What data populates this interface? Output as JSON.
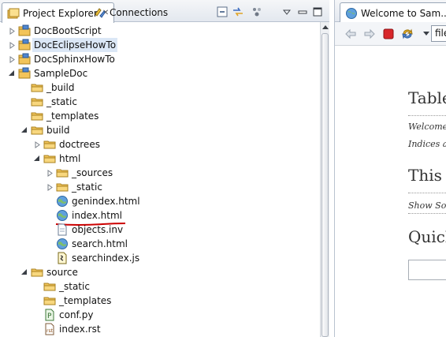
{
  "left_tabs": [
    {
      "label": "Project Explorer",
      "icon": "project-explorer-icon",
      "active": true
    },
    {
      "label": "Connections",
      "icon": "connections-icon",
      "active": false
    }
  ],
  "left_toolbar": [
    "collapse-all-icon",
    "link-with-editor-icon",
    "filter-icon",
    "view-menu-icon",
    "minimize-icon",
    "maximize-icon"
  ],
  "tree": [
    {
      "label": "DocBootScript",
      "icon": "project-icon",
      "expanded": false
    },
    {
      "label": "DocEclipseHowTo",
      "icon": "project-icon",
      "expanded": false,
      "highlighted": true
    },
    {
      "label": "DocSphinxHowTo",
      "icon": "project-icon",
      "expanded": false
    },
    {
      "label": "SampleDoc",
      "icon": "project-icon",
      "expanded": true
    },
    {
      "label": "_build",
      "icon": "folder-icon"
    },
    {
      "label": "_static",
      "icon": "folder-icon"
    },
    {
      "label": "_templates",
      "icon": "folder-icon"
    },
    {
      "label": "build",
      "icon": "folder-icon",
      "expanded": true
    },
    {
      "label": "doctrees",
      "icon": "folder-icon",
      "expanded": false
    },
    {
      "label": "html",
      "icon": "folder-icon",
      "expanded": true
    },
    {
      "label": "_sources",
      "icon": "folder-icon",
      "expanded": false
    },
    {
      "label": "_static",
      "icon": "folder-icon",
      "expanded": false
    },
    {
      "label": "genindex.html",
      "icon": "globe-icon"
    },
    {
      "label": "index.html",
      "icon": "globe-icon",
      "underlined": true
    },
    {
      "label": "objects.inv",
      "icon": "file-icon"
    },
    {
      "label": "search.html",
      "icon": "globe-icon"
    },
    {
      "label": "searchindex.js",
      "icon": "js-file-icon"
    },
    {
      "label": "source",
      "icon": "folder-icon",
      "expanded": true
    },
    {
      "label": "_static",
      "icon": "folder-icon"
    },
    {
      "label": "_templates",
      "icon": "folder-icon"
    },
    {
      "label": "conf.py",
      "icon": "python-file-icon"
    },
    {
      "label": "index.rst",
      "icon": "rst-file-icon"
    }
  ],
  "right_tab": {
    "label": "Welcome to Sam...",
    "icon": "globe-icon"
  },
  "browser_toolbar": [
    "back-icon",
    "forward-icon",
    "stop-icon",
    "refresh-icon",
    "dropdown-icon"
  ],
  "url_value": "file",
  "page": {
    "heading1": "Table",
    "line1": "Welcome",
    "line2": "Indices an",
    "heading2": "This P",
    "line3": "Show Sou",
    "heading3": "Quick"
  },
  "colors": {
    "highlight": "#dbe7f6",
    "red_underline": "#cc0000"
  }
}
